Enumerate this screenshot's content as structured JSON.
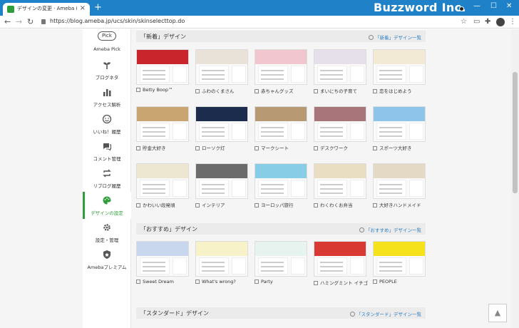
{
  "browser": {
    "tab_title": "デザインの変更 · Ameba (アメーバ)",
    "url": "https://blog.ameba.jp/ucs/skin/skinselecttop.do",
    "brand": "Buzzword Inc."
  },
  "sidebar": {
    "items": [
      {
        "label": "Ameba Pick",
        "badge": "Pick"
      },
      {
        "label": "ブログネタ"
      },
      {
        "label": "アクセス解析"
      },
      {
        "label": "いいね！履歴"
      },
      {
        "label": "コメント管理"
      },
      {
        "label": "リブログ履歴"
      },
      {
        "label": "デザインの設定"
      },
      {
        "label": "設定・管理"
      },
      {
        "label": "Amebaプレミアム"
      }
    ]
  },
  "sections": [
    {
      "title": "「新着」デザイン",
      "more": "「新着」デザイン一覧",
      "cards": [
        {
          "label": "Betty Boop™",
          "color": "#c8252c"
        },
        {
          "label": "ふわのくまさん",
          "color": "#e9e2d8"
        },
        {
          "label": "赤ちゃんグッズ",
          "color": "#f2c6cf"
        },
        {
          "label": "まいにちの子育て",
          "color": "#e6e0ea"
        },
        {
          "label": "恋をはじめよう",
          "color": "#f3ead5"
        },
        {
          "label": "貯金大好き",
          "color": "#c9a572"
        },
        {
          "label": "ローソク灯",
          "color": "#1c2c4c"
        },
        {
          "label": "マークシート",
          "color": "#b79a74"
        },
        {
          "label": "デスクワーク",
          "color": "#a8757b"
        },
        {
          "label": "スポーツ大好き",
          "color": "#8ec3ea"
        },
        {
          "label": "かわいい段発頃",
          "color": "#ede7d1"
        },
        {
          "label": "インテリア",
          "color": "#6b6b6b"
        },
        {
          "label": "ヨーロッパ旅行",
          "color": "#88cde6"
        },
        {
          "label": "わくわくお弁当",
          "color": "#e9ddc2"
        },
        {
          "label": "大好きハンドメイド",
          "color": "#e4d9c4"
        }
      ]
    },
    {
      "title": "「おすすめ」デザイン",
      "more": "「おすすめ」デザイン一覧",
      "cards": [
        {
          "label": "Sweet Dream",
          "color": "#c9d7ee"
        },
        {
          "label": "What's wrong?",
          "color": "#f8f2c8"
        },
        {
          "label": "Party",
          "color": "#e7f3ee"
        },
        {
          "label": "ハミングミント イチゴ",
          "color": "#d83a33"
        },
        {
          "label": "PEOPLE",
          "color": "#f5e21a"
        }
      ]
    },
    {
      "title": "「スタンダード」デザイン",
      "more": "「スタンダード」デザイン一覧",
      "cards": []
    }
  ],
  "scroll_top_icon": "arrow-up-icon"
}
